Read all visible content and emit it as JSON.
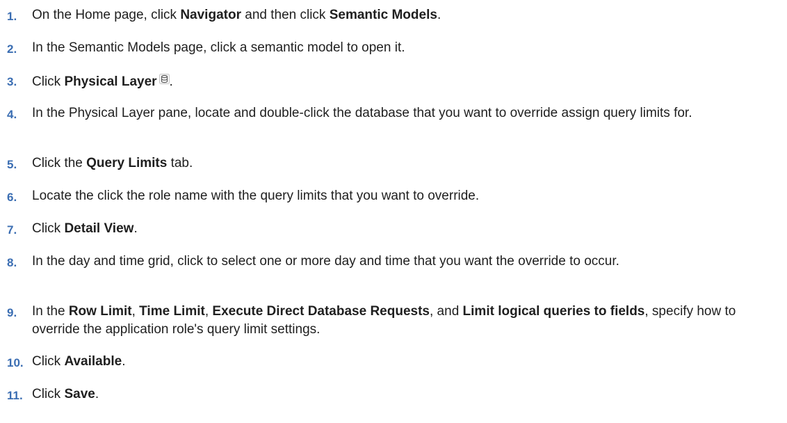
{
  "steps": [
    {
      "num": "1.",
      "parts": [
        {
          "t": "On the Home page, click ",
          "b": false
        },
        {
          "t": "Navigator",
          "b": true
        },
        {
          "t": " and then click ",
          "b": false
        },
        {
          "t": "Semantic Models",
          "b": true
        },
        {
          "t": ".",
          "b": false
        }
      ]
    },
    {
      "num": "2.",
      "parts": [
        {
          "t": "In the Semantic Models page, click a semantic model to open it.",
          "b": false
        }
      ]
    },
    {
      "num": "3.",
      "parts": [
        {
          "t": "Click ",
          "b": false
        },
        {
          "t": "Physical Layer",
          "b": true
        },
        {
          "icon": "database-icon"
        },
        {
          "t": ".",
          "b": false
        }
      ]
    },
    {
      "num": "4.",
      "parts": [
        {
          "t": "In the Physical Layer pane, locate and double-click the database that you want to override assign query limits for.",
          "b": false
        }
      ]
    },
    {
      "num": "5.",
      "parts": [
        {
          "t": "Click the ",
          "b": false
        },
        {
          "t": "Query Limits",
          "b": true
        },
        {
          "t": " tab.",
          "b": false
        }
      ]
    },
    {
      "num": "6.",
      "parts": [
        {
          "t": "Locate the click the role name with the query limits that you want to override.",
          "b": false
        }
      ]
    },
    {
      "num": "7.",
      "parts": [
        {
          "t": "Click ",
          "b": false
        },
        {
          "t": "Detail View",
          "b": true
        },
        {
          "t": ".",
          "b": false
        }
      ]
    },
    {
      "num": "8.",
      "parts": [
        {
          "t": "In the day and time grid, click to select one or more day and time that you want the override to occur.",
          "b": false
        }
      ]
    },
    {
      "num": "9.",
      "parts": [
        {
          "t": "In the ",
          "b": false
        },
        {
          "t": "Row Limit",
          "b": true
        },
        {
          "t": ", ",
          "b": false
        },
        {
          "t": "Time Limit",
          "b": true
        },
        {
          "t": ", ",
          "b": false
        },
        {
          "t": "Execute Direct Database Requests",
          "b": true
        },
        {
          "t": ", and ",
          "b": false
        },
        {
          "t": "Limit logical queries to fields",
          "b": true
        },
        {
          "t": ", specify how to override the application role's query limit settings.",
          "b": false
        }
      ]
    },
    {
      "num": "10.",
      "parts": [
        {
          "t": "Click ",
          "b": false
        },
        {
          "t": "Available",
          "b": true
        },
        {
          "t": ".",
          "b": false
        }
      ]
    },
    {
      "num": "11.",
      "parts": [
        {
          "t": "Click ",
          "b": false
        },
        {
          "t": "Save",
          "b": true
        },
        {
          "t": ".",
          "b": false
        }
      ]
    }
  ]
}
